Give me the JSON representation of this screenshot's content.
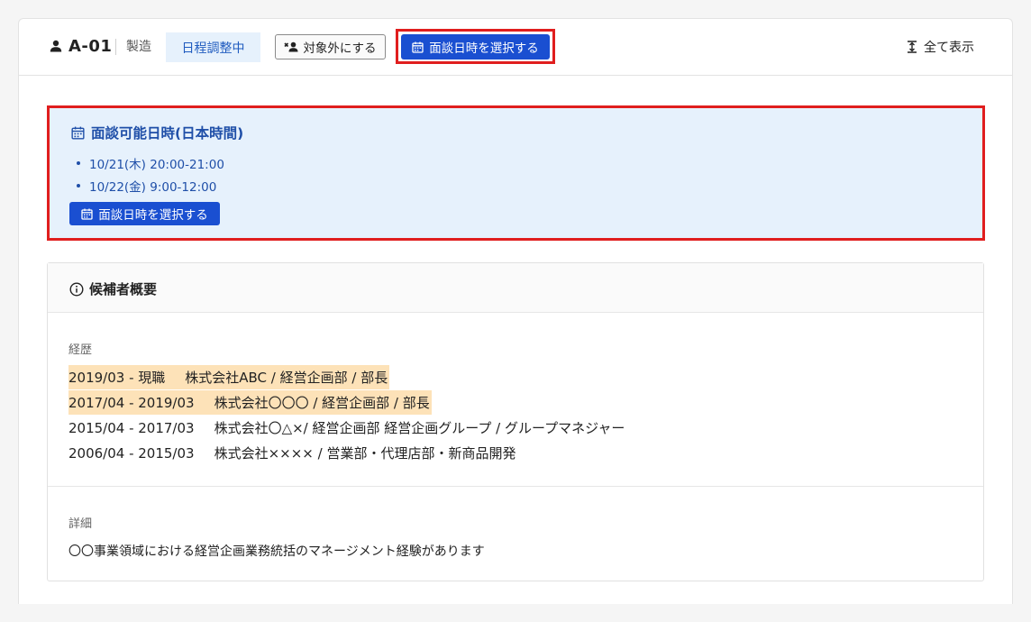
{
  "header": {
    "candidate_id": "A-01",
    "industry": "製造",
    "status": "日程調整中",
    "exclude_label": "対象外にする",
    "select_datetime_label": "面談日時を選択する",
    "show_all_label": "全て表示"
  },
  "availability": {
    "title": "面談可能日時(日本時間)",
    "slots": [
      "10/21(木) 20:00-21:00",
      "10/22(金) 9:00-12:00"
    ],
    "select_datetime_label": "面談日時を選択する"
  },
  "summary": {
    "title": "候補者概要",
    "career_label": "経歴",
    "career": [
      {
        "period": "2019/03 - 現職",
        "company": "株式会社ABC / 経営企画部 / 部長",
        "highlighted": true
      },
      {
        "period": "2017/04 - 2019/03",
        "company": "株式会社〇〇〇 / 経営企画部 / 部長",
        "highlighted": true
      },
      {
        "period": "2015/04 - 2017/03",
        "company": "株式会社〇△×/ 経営企画部 経営企画グループ / グループマネジャー",
        "highlighted": false
      },
      {
        "period": "2006/04 - 2015/03",
        "company": "株式会社×××× / 営業部・代理店部・新商品開発",
        "highlighted": false
      }
    ],
    "detail_label": "詳細",
    "detail_text": "〇〇事業領域における経営企画業務統括のマネージメント経験があります"
  },
  "colors": {
    "primary": "#1a4fd1",
    "highlight_border": "#e01e1e",
    "availability_bg": "#e6f1fc",
    "career_highlight": "#fde2b8"
  },
  "icons": [
    "person-icon",
    "person-remove-icon",
    "calendar-icon",
    "expand-vertical-icon",
    "info-icon"
  ]
}
